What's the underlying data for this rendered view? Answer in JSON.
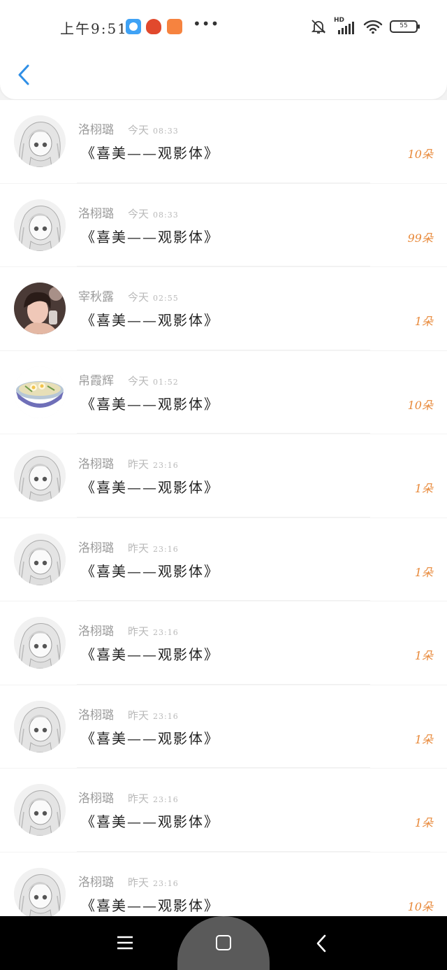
{
  "status_bar": {
    "time": "上午9:51",
    "more": "•••",
    "battery": "55",
    "network": "HD",
    "app_icons": [
      "blue-app-icon",
      "red-app-icon",
      "orange-bag-app-icon"
    ],
    "icons": [
      "bell-muted-icon",
      "signal-icon",
      "wifi-icon",
      "battery-icon"
    ]
  },
  "header": {
    "back_icon": "chevron-left-icon",
    "accent": "#2f8fe6"
  },
  "colors": {
    "count": "#e8893a",
    "name": "#9b9b9b",
    "title": "#222222"
  },
  "items": [
    {
      "name": "洛栩璐",
      "date": "今天",
      "time": "08:33",
      "title": "《喜美——观影体》",
      "count": "10朵",
      "avatar": "anime-girl"
    },
    {
      "name": "洛栩璐",
      "date": "今天",
      "time": "08:33",
      "title": "《喜美——观影体》",
      "count": "99朵",
      "avatar": "anime-girl"
    },
    {
      "name": "宰秋露",
      "date": "今天",
      "time": "02:55",
      "title": "《喜美——观影体》",
      "count": "1朵",
      "avatar": "selfie-photo"
    },
    {
      "name": "帛霞辉",
      "date": "今天",
      "time": "01:52",
      "title": "《喜美——观影体》",
      "count": "10朵",
      "avatar": "noodle-bowl"
    },
    {
      "name": "洛栩璐",
      "date": "昨天",
      "time": "23:16",
      "title": "《喜美——观影体》",
      "count": "1朵",
      "avatar": "anime-girl"
    },
    {
      "name": "洛栩璐",
      "date": "昨天",
      "time": "23:16",
      "title": "《喜美——观影体》",
      "count": "1朵",
      "avatar": "anime-girl"
    },
    {
      "name": "洛栩璐",
      "date": "昨天",
      "time": "23:16",
      "title": "《喜美——观影体》",
      "count": "1朵",
      "avatar": "anime-girl"
    },
    {
      "name": "洛栩璐",
      "date": "昨天",
      "time": "23:16",
      "title": "《喜美——观影体》",
      "count": "1朵",
      "avatar": "anime-girl"
    },
    {
      "name": "洛栩璐",
      "date": "昨天",
      "time": "23:16",
      "title": "《喜美——观影体》",
      "count": "1朵",
      "avatar": "anime-girl"
    },
    {
      "name": "洛栩璐",
      "date": "昨天",
      "time": "23:16",
      "title": "《喜美——观影体》",
      "count": "10朵",
      "avatar": "anime-girl"
    }
  ],
  "nav": {
    "menu_icon": "menu-icon",
    "home_icon": "home-square-icon",
    "back_icon": "back-triangle-icon"
  }
}
